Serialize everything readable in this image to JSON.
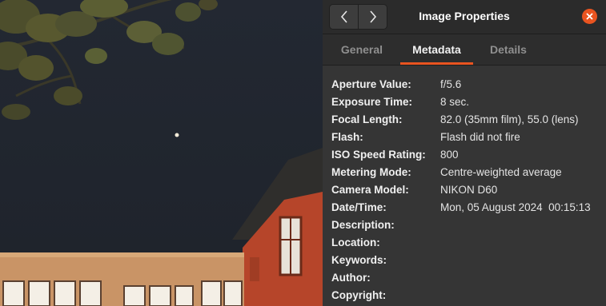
{
  "window": {
    "title": "Image Properties",
    "nav_back_icon": "chevron-left-icon",
    "nav_forward_icon": "chevron-right-icon",
    "close_icon": "close-icon"
  },
  "tabs": [
    {
      "label": "General",
      "active": false
    },
    {
      "label": "Metadata",
      "active": true
    },
    {
      "label": "Details",
      "active": false
    }
  ],
  "colors": {
    "accent": "#e95420",
    "dialog_bg": "#353535",
    "headerbar_bg": "#2b2b2b"
  },
  "metadata": [
    {
      "label": "Aperture Value:",
      "value": "f/5.6"
    },
    {
      "label": "Exposure Time:",
      "value": "8 sec."
    },
    {
      "label": "Focal Length:",
      "value": "82.0 (35mm film), 55.0 (lens)"
    },
    {
      "label": "Flash:",
      "value": "Flash did not fire"
    },
    {
      "label": "ISO Speed Rating:",
      "value": "800"
    },
    {
      "label": "Metering Mode:",
      "value": "Centre-weighted average"
    },
    {
      "label": "Camera Model:",
      "value": "NIKON D60"
    },
    {
      "label": "Date/Time:",
      "value": "Mon, 05 August 2024  00:15:13"
    },
    {
      "label": "Description:",
      "value": ""
    },
    {
      "label": "Location:",
      "value": ""
    },
    {
      "label": "Keywords:",
      "value": ""
    },
    {
      "label": "Author:",
      "value": ""
    },
    {
      "label": "Copyright:",
      "value": ""
    }
  ]
}
